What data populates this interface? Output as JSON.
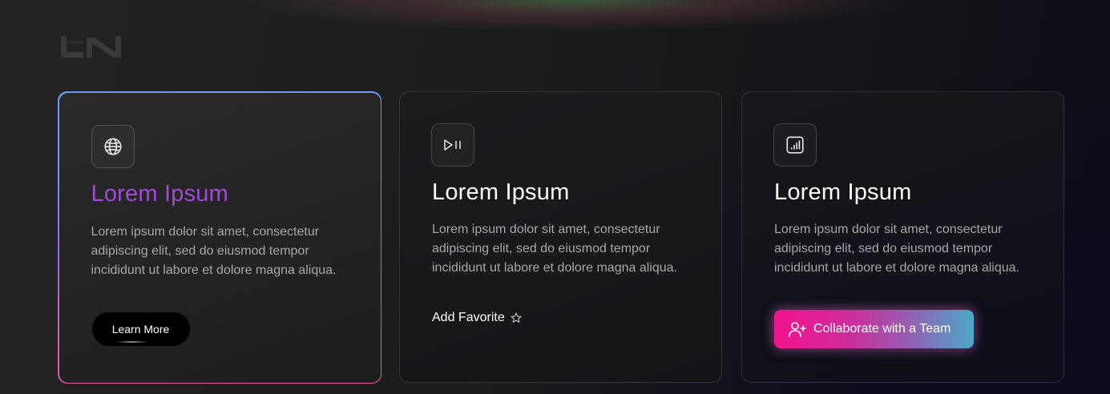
{
  "brand": {
    "logo_icon": "un-logo-icon"
  },
  "colors": {
    "title_accent": "#a14ad8",
    "border_gradient": [
      "#6a9df0",
      "#9a6ce0",
      "#e05aa0"
    ],
    "collab_gradient": [
      "#f2148c",
      "#4aa8c8"
    ]
  },
  "cards": [
    {
      "icon": "globe-icon",
      "title": "Lorem Ipsum",
      "description": "Lorem ipsum dolor sit amet, consectetur adipiscing elit, sed do eiusmod tempor incididunt ut labore et dolore magna aliqua.",
      "button_label": "Learn More"
    },
    {
      "icon": "play-pause-icon",
      "title": "Lorem Ipsum",
      "description": "Lorem ipsum dolor sit amet, consectetur adipiscing elit, sed do eiusmod tempor incididunt ut labore et dolore magna aliqua.",
      "link_label": "Add Favorite",
      "link_icon": "star-icon"
    },
    {
      "icon": "bar-chart-icon",
      "title": "Lorem Ipsum",
      "description": "Lorem ipsum dolor sit amet, consectetur adipiscing elit, sed do eiusmod tempor incididunt ut labore et dolore magna aliqua.",
      "button_label": "Collaborate with a Team",
      "button_icon": "add-user-icon"
    }
  ]
}
